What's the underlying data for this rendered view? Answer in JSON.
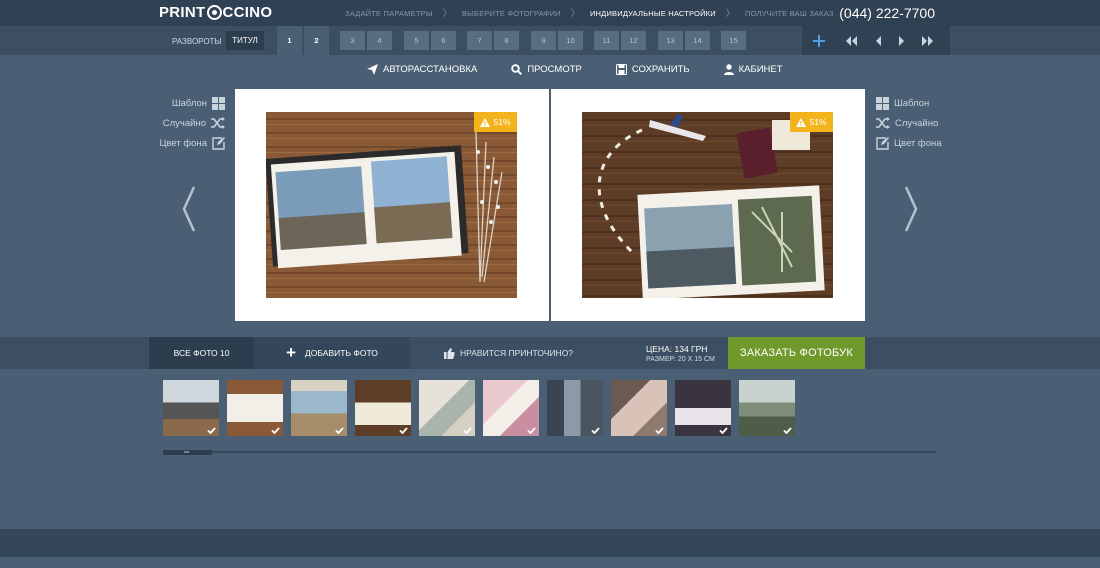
{
  "header": {
    "logo_left": "PRINT",
    "logo_right": "CCINO",
    "steps": [
      "ЗАДАЙТЕ ПАРАМЕТРЫ",
      "ВЫБЕРИТЕ ФОТОГРАФИИ",
      "ИНДИВИДУАЛЬНЫЕ НАСТРОЙКИ",
      "ПОЛУЧИТЕ ВАШ ЗАКАЗ"
    ],
    "active_step_index": 2,
    "phone": "(044) 222-7700"
  },
  "spreads": {
    "label": "РАЗВОРОТЫ",
    "title_button": "ТИТУЛ",
    "pages": [
      "1",
      "2",
      "3",
      "4",
      "5",
      "6",
      "7",
      "8",
      "9",
      "10",
      "11",
      "12",
      "13",
      "14",
      "15"
    ],
    "active_pages": [
      "1",
      "2"
    ]
  },
  "toolbar": {
    "auto": "АВТОРАССТАНОВКА",
    "preview": "ПРОСМОТР",
    "save": "СОХРАНИТЬ",
    "cabinet": "КАБИНЕТ"
  },
  "side_tools": {
    "template": "Шаблон",
    "random": "Случайно",
    "bg_color": "Цвет фона"
  },
  "pages": {
    "left_quality": "51%",
    "right_quality": "51%"
  },
  "actionbar": {
    "all_photos": "ВСЕ ФОТО 10",
    "add_photo": "ДОБАВИТЬ ФОТО",
    "like": "НРАВИТСЯ ПРИНТОЧИНО?",
    "price": "ЦЕНА: 134 ГРН",
    "size": "РАЗМЕР: 20 Х 15 СМ",
    "order": "ЗАКАЗАТЬ ФОТОБУК"
  },
  "colors": {
    "background": "#4a5f74",
    "header": "#2f4153",
    "order_button": "#6f9a2b",
    "quality_badge": "#f2b31c"
  }
}
